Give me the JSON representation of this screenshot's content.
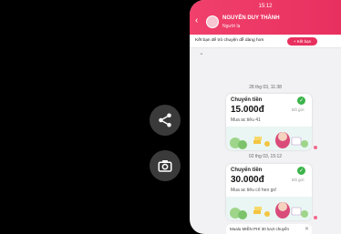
{
  "status_bar": {
    "time": "15:12"
  },
  "header": {
    "back_icon": "chevron-left-icon",
    "name": "NGUYỄN DUY THÀNH",
    "subtitle": "Người lạ"
  },
  "friend_bar": {
    "text": "Kết bạn để trò chuyện dễ dàng hơn",
    "button_label": "Kết bạn"
  },
  "messages": [
    {
      "timestamp": "28 thg 03, 11:38",
      "title": "Chuyển tiền",
      "amount": "15.000đ",
      "note": "Mua ac tiêu 41",
      "status": "Đã gửi"
    },
    {
      "timestamp": "02 thg 03, 15:12",
      "title": "Chuyển tiền",
      "amount": "30.000đ",
      "note": "Mua ac tiêu cố heo gs!",
      "status": "Đã gửi"
    }
  ],
  "bottom_message": {
    "text": "Mualu MIỄN PHÍ 30 lượt chuyển"
  },
  "colors": {
    "brand": "#e8305f",
    "check": "#3bb34a"
  },
  "side_actions": [
    "share-icon",
    "camera-icon"
  ]
}
